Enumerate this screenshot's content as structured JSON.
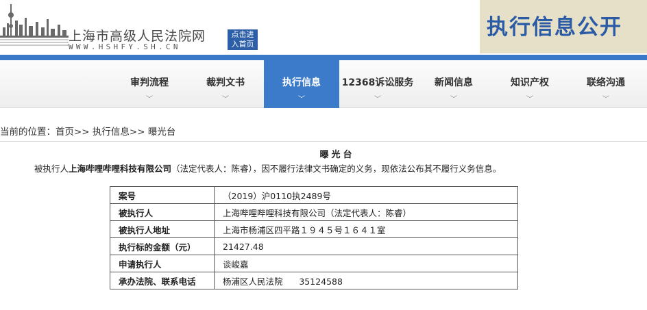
{
  "header": {
    "site_name": "上海市高级人民法院网",
    "site_url": "WWW.HSHFY.SH.CN",
    "enter_home_line1": "点击进",
    "enter_home_line2": "入首页",
    "banner_title": "执行信息公开"
  },
  "nav": {
    "items": [
      {
        "label": "审判流程"
      },
      {
        "label": "裁判文书"
      },
      {
        "label": "执行信息"
      },
      {
        "label": "12368诉讼服务"
      },
      {
        "label": "新闻信息"
      },
      {
        "label": "知识产权"
      },
      {
        "label": "联络沟通"
      }
    ],
    "chevron": "﹀",
    "active_index": 2
  },
  "breadcrumb": {
    "prefix": "当前的位置：",
    "home": "首页",
    "sep1": ">> ",
    "section": "执行信息",
    "sep2": ">> ",
    "current": "曝光台"
  },
  "content": {
    "title": "曝光台",
    "intro_prefix": "被执行人",
    "intro_company": "上海哔哩哔哩科技有限公司",
    "intro_suffix": "（法定代表人：陈睿），因不履行法律文书确定的义务，现依法公布其不履行义务信息。",
    "rows": [
      {
        "key": "案号",
        "value": "（2019）沪0110执2489号"
      },
      {
        "key": "被执行人",
        "value": "上海哔哩哔哩科技有限公司（法定代表人：陈睿）"
      },
      {
        "key": "被执行人地址",
        "value": "上海市杨浦区四平路１９４５号１６４１室"
      },
      {
        "key": "执行标的金额（元）",
        "value": "21427.48"
      },
      {
        "key": "申请执行人",
        "value": "谈峻嘉"
      },
      {
        "key": "承办法院、联系电话",
        "value": "杨浦区人民法院      35124588"
      }
    ]
  }
}
